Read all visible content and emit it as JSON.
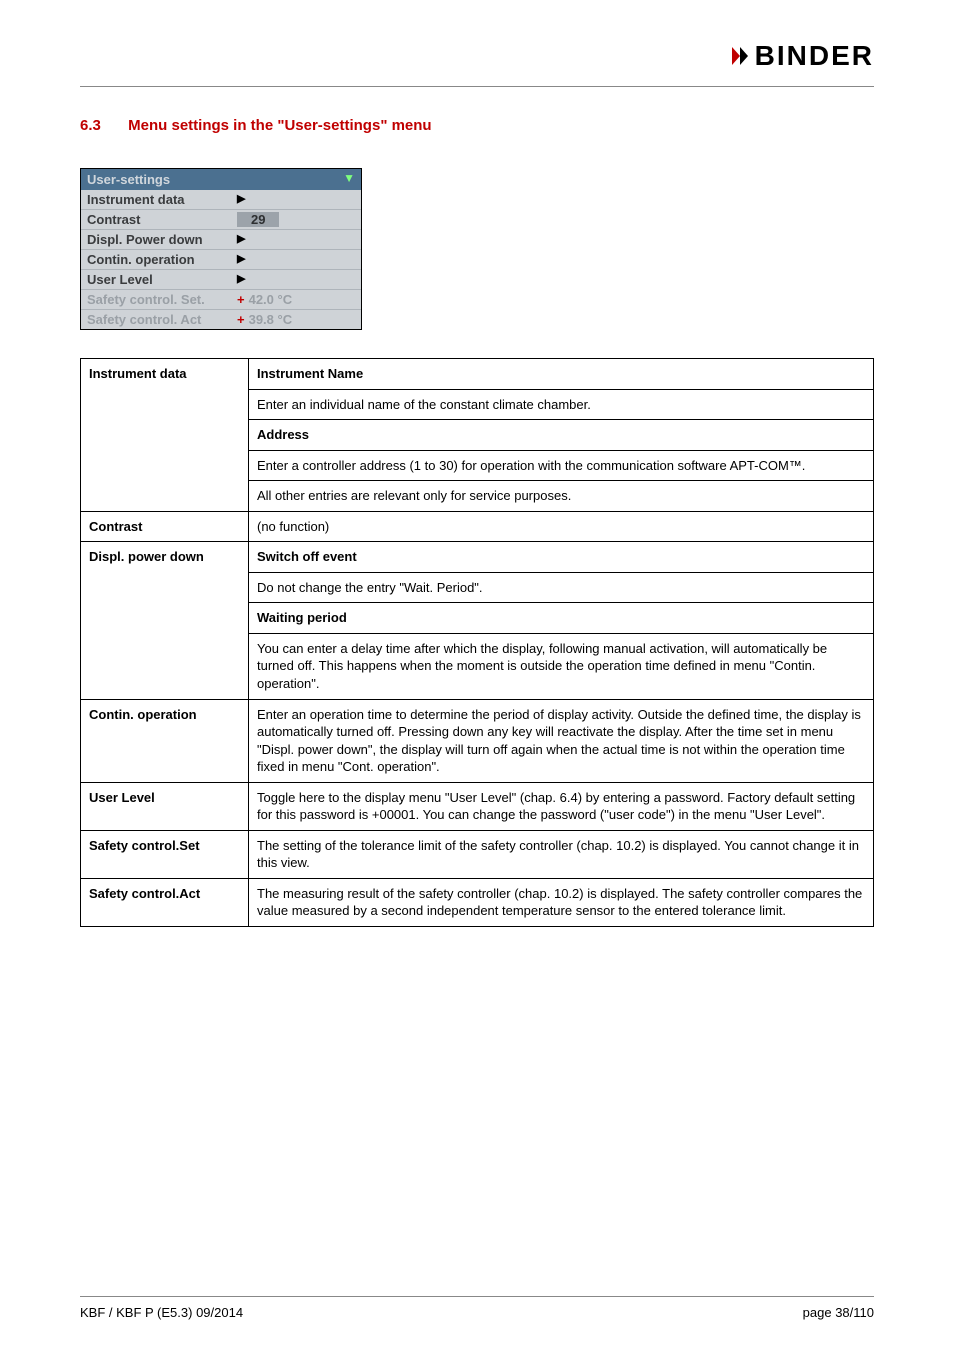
{
  "brand": {
    "name": "BINDER"
  },
  "heading": {
    "number": "6.3",
    "title": "Menu settings in the \"User-settings\" menu"
  },
  "panel": {
    "title": "User-settings",
    "rows": {
      "instrument_data": {
        "label": "Instrument data",
        "value": "▶"
      },
      "contrast": {
        "label": "Contrast",
        "value": "29"
      },
      "power_down": {
        "label": "Displ. Power down",
        "value": "▶"
      },
      "contin": {
        "label": "Contin. operation",
        "value": "▶"
      },
      "user_level": {
        "label": "User Level",
        "value": "▶"
      },
      "safety_set": {
        "label": "Safety control. Set.",
        "value": "42.0  °C"
      },
      "safety_act": {
        "label": "Safety control. Act",
        "value": "39.8  °C"
      }
    }
  },
  "table": {
    "instrument_data": {
      "label": "Instrument data",
      "h1": "Instrument Name",
      "p1": "Enter an individual name of the constant climate chamber.",
      "h2": "Address",
      "p2": "Enter a controller address (1 to 30) for operation with the communication software APT-COM™.",
      "p3": "All other entries are relevant only for service purposes."
    },
    "contrast": {
      "label": "Contrast",
      "value": "(no function)"
    },
    "power_down": {
      "label": "Displ. power down",
      "h1": "Switch off event",
      "p1": "Do not change the entry \"Wait. Period\".",
      "h2": "Waiting period",
      "p2": "You can enter a delay time after which the display, following manual activation, will automatically be turned off. This happens when the moment is outside the operation time defined in menu \"Contin. operation\"."
    },
    "contin": {
      "label": "Contin. operation",
      "value": "Enter an operation time to determine the period of display activity. Outside the defined time, the display is automatically turned off. Pressing down any key will reactivate the display. After the time set in menu \"Displ. power down\", the display will turn off again when the actual time is not within the operation time fixed in menu \"Cont. operation\"."
    },
    "user_level": {
      "label": "User Level",
      "value": "Toggle here to the display menu \"User Level\" (chap. 6.4) by entering a password. Factory default setting for this password is +00001. You can change the password (\"user code\") in the menu \"User Level\"."
    },
    "safety_set": {
      "label": "Safety control.Set",
      "value": "The setting of the tolerance limit of the safety controller (chap. 10.2) is displayed. You cannot change it in this view."
    },
    "safety_act": {
      "label": "Safety control.Act",
      "value": "The measuring result of the safety controller (chap. 10.2) is displayed. The safety controller compares the value measured by a second independent temperature sensor to the entered tolerance limit."
    }
  },
  "footer": {
    "left": "KBF / KBF P (E5.3) 09/2014",
    "right": "page 38/110"
  }
}
